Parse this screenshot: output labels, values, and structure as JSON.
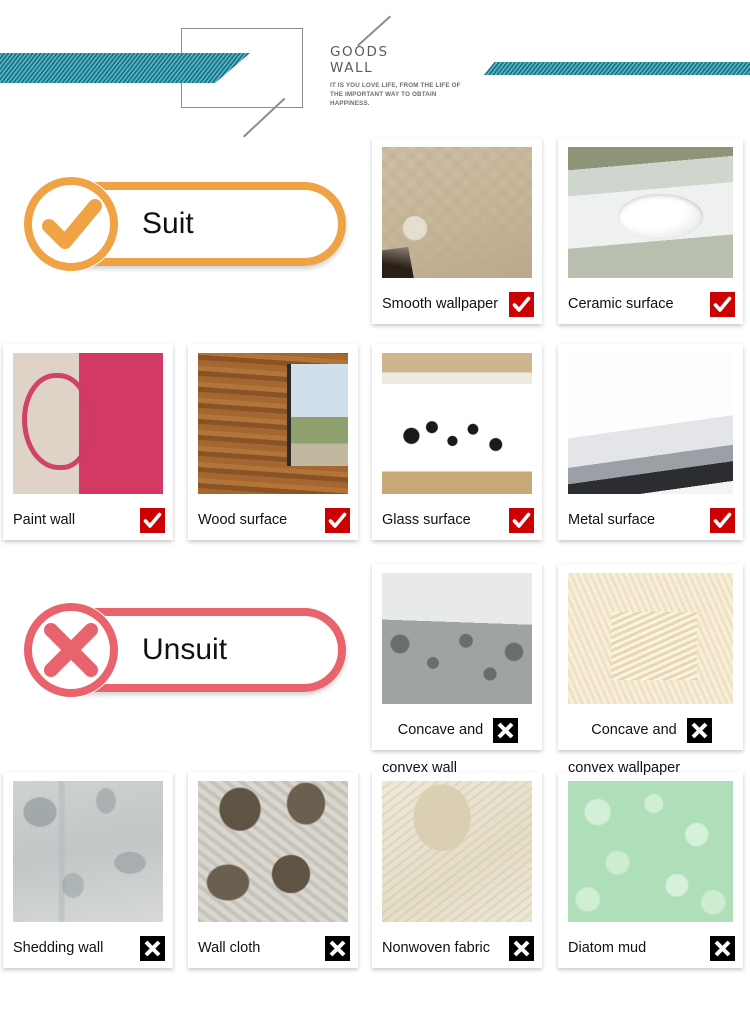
{
  "header": {
    "title_lines": [
      "GOODS",
      "WALL"
    ],
    "tagline": "IT IS YOU LOVE LIFE, FROM THE LIFE OF THE IMPORTANT WAY TO OBTAIN HAPPINESS.",
    "stripe_color": "#1d6e80",
    "stripe_highlight": "#53b9c9",
    "frame_color": "#8c8c8c"
  },
  "sections": [
    {
      "id": "suit",
      "badge_label": "Suit",
      "badge_color": "#f0a345",
      "badge_icon": "check-circle-icon",
      "mark_type": "check",
      "mark_color": "#cc0202"
    },
    {
      "id": "unsuit",
      "badge_label": "Unsuit",
      "badge_color": "#e8636c",
      "badge_icon": "cross-circle-icon",
      "mark_type": "cross",
      "mark_color": "#000000"
    }
  ],
  "cards": [
    {
      "label": "Smooth wallpaper",
      "label_line2": "",
      "mark": "check",
      "texture": "ph-wallpaper"
    },
    {
      "label": "Ceramic surface",
      "label_line2": "",
      "mark": "check",
      "texture": "ph-ceramic"
    },
    {
      "label": "Paint wall",
      "label_line2": "",
      "mark": "check",
      "texture": "ph-paint"
    },
    {
      "label": "Wood surface",
      "label_line2": "",
      "mark": "check",
      "texture": "ph-wood"
    },
    {
      "label": "Glass surface",
      "label_line2": "",
      "mark": "check",
      "texture": "ph-glass"
    },
    {
      "label": "Metal surface",
      "label_line2": "",
      "mark": "check",
      "texture": "ph-metal"
    },
    {
      "label": "Concave and",
      "label_line2": "convex wall",
      "mark": "cross",
      "texture": "ph-concave-wall"
    },
    {
      "label": "Concave and",
      "label_line2": "convex wallpaper",
      "mark": "cross",
      "texture": "ph-concave-paper"
    },
    {
      "label": "Shedding wall",
      "label_line2": "",
      "mark": "cross",
      "texture": "ph-shedding"
    },
    {
      "label": "Wall cloth",
      "label_line2": "",
      "mark": "cross",
      "texture": "ph-wallcloth"
    },
    {
      "label": "Nonwoven fabric",
      "label_line2": "",
      "mark": "cross",
      "texture": "ph-nonwoven"
    },
    {
      "label": "Diatom mud",
      "label_line2": "",
      "mark": "cross",
      "texture": "ph-diatom"
    }
  ]
}
